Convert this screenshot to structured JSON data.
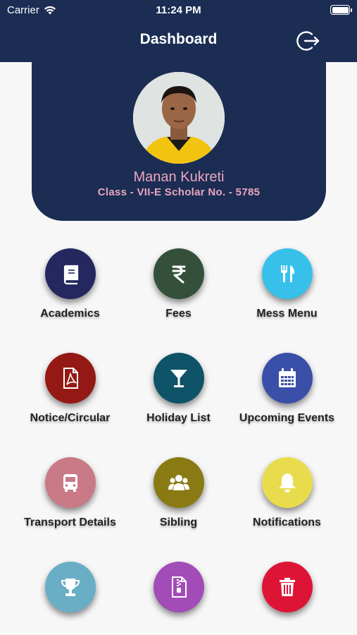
{
  "status_bar": {
    "carrier": "Carrier",
    "time": "11:24 PM"
  },
  "header": {
    "title": "Dashboard"
  },
  "profile": {
    "name": "Manan Kukreti",
    "class_line": "Class - VII-E Scholar No. - 5785"
  },
  "colors": {
    "header_bg": "#1c2d54",
    "accent_text": "#e9a6bd"
  },
  "tiles": [
    {
      "label": "Academics",
      "icon": "book-icon",
      "color": "#24285f"
    },
    {
      "label": "Fees",
      "icon": "rupee-icon",
      "color": "#35503a"
    },
    {
      "label": "Mess Menu",
      "icon": "fork-knife-icon",
      "color": "#37c1ea"
    },
    {
      "label": "Notice/Circular",
      "icon": "pdf-document-icon",
      "color": "#941914"
    },
    {
      "label": "Holiday List",
      "icon": "cocktail-glass-icon",
      "color": "#0e5367"
    },
    {
      "label": "Upcoming Events",
      "icon": "calendar-icon",
      "color": "#3a4fa8"
    },
    {
      "label": "Transport Details",
      "icon": "bus-icon",
      "color": "#c97a86"
    },
    {
      "label": "Sibling",
      "icon": "users-icon",
      "color": "#8a7a14"
    },
    {
      "label": "Notifications",
      "icon": "bell-icon",
      "color": "#e9dc4c"
    },
    {
      "label": "",
      "icon": "trophy-icon",
      "color": "#6aaec5"
    },
    {
      "label": "",
      "icon": "zip-file-icon",
      "color": "#a24cb8"
    },
    {
      "label": "",
      "icon": "trash-icon",
      "color": "#de1437"
    }
  ]
}
